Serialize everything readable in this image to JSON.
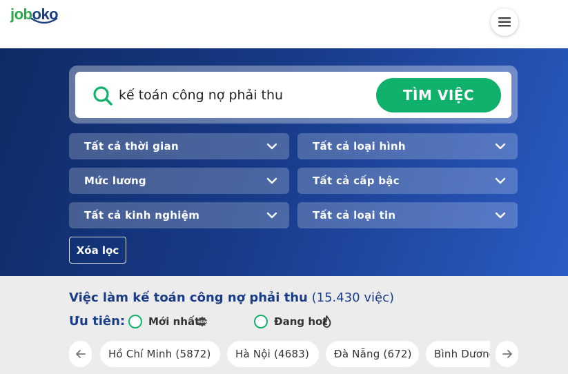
{
  "header": {
    "logo_part1": "job",
    "logo_part2": "oko",
    "menu_icon": "hamburger-icon"
  },
  "search": {
    "value": "kế toán công nợ phải thu",
    "button_label": "TÌM VIỆC",
    "icon": "search-icon"
  },
  "filters": {
    "time": "Tất cả thời gian",
    "type": "Tất cả loại hình",
    "salary": "Mức lương",
    "level": "Tất cả cấp bậc",
    "experience": "Tất cả kinh nghiệm",
    "post_type": "Tất cả loại tin"
  },
  "clear_label": "Xóa lọc",
  "results": {
    "title": "Việc làm kế toán công nợ phải thu",
    "count": "(15.430 việc)"
  },
  "priority": {
    "label": "Ưu tiên:",
    "newest": "Mới nhất",
    "hot": "Đang hot"
  },
  "locations": [
    "Hồ Chí Minh (5872)",
    "Hà Nội (4683)",
    "Đà Nẵng (672)",
    "Bình Dương"
  ],
  "colors": {
    "brand_green": "#10b16a",
    "brand_blue": "#1a3d8a",
    "hero_dark": "#0f2b66",
    "hero_light": "#2b5bc4"
  }
}
